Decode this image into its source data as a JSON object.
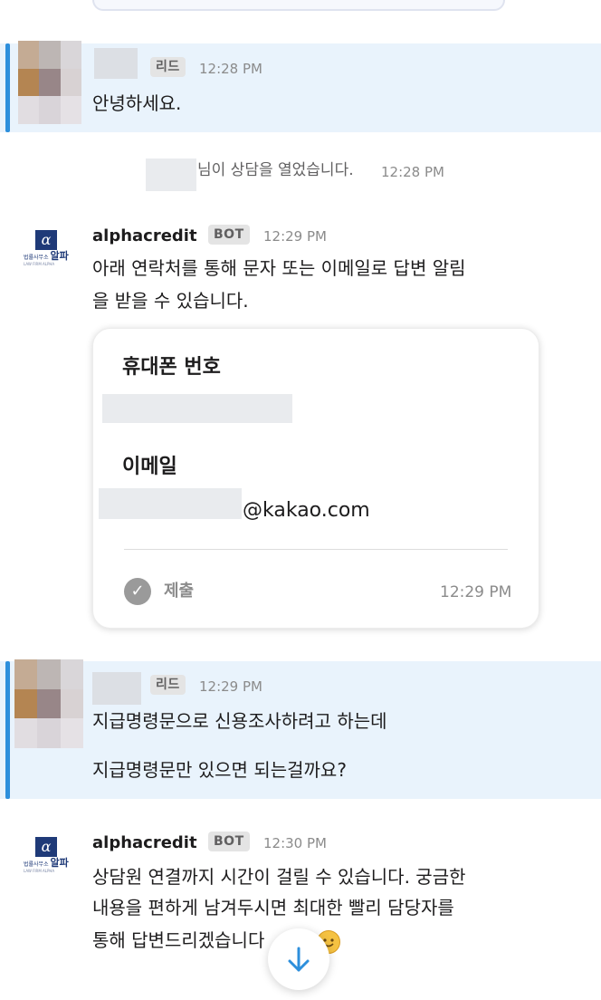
{
  "messages": {
    "lead_1": {
      "badge": "리드",
      "time": "12:28 PM",
      "text": "안녕하세요."
    },
    "system": {
      "text": "님이 상담을 열었습니다.",
      "time": "12:28 PM"
    },
    "bot_1": {
      "sender": "alphacredit",
      "badge": "BOT",
      "time": "12:29 PM",
      "text_line1": "아래 연락처를 통해 문자 또는 이메일로 답변 알림",
      "text_line2": "을 받을 수 있습니다."
    },
    "form": {
      "phone_label": "휴대폰 번호",
      "email_label": "이메일",
      "email_domain": "@kakao.com",
      "status": "제출",
      "time": "12:29 PM"
    },
    "lead_2": {
      "badge": "리드",
      "time": "12:29 PM",
      "line1": "지급명령문으로 신용조사하려고 하는데",
      "line2": "지급명령문만 있으면 되는걸까요?"
    },
    "bot_2": {
      "sender": "alphacredit",
      "badge": "BOT",
      "time": "12:30 PM",
      "line1": "상담원 연결까지 시간이 걸릴 수 있습니다. 궁금한",
      "line2": "내용을 편하게 남겨두시면 최대한 빨리 담당자를",
      "line3": "통해 답변드리겠습니다"
    }
  },
  "bot_logo": {
    "symbol": "α",
    "name_small": "법률사무소",
    "name_big": "알파",
    "subtitle": "LAW FIRM ALPHA"
  },
  "icons": {
    "check": "check-icon",
    "scroll": "arrow-down-icon",
    "emoji": "smile-emoji-icon"
  },
  "colors": {
    "lead_bg": "#e9f3fc",
    "lead_bar": "#2d8fdc",
    "logo_navy": "#1f3a78",
    "scroll_arrow": "#2d8fdc"
  }
}
